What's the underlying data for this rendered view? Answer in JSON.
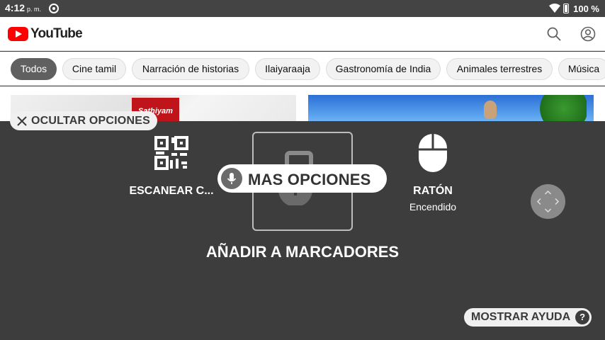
{
  "status_bar": {
    "time": "4:12",
    "ampm": "p. m.",
    "battery": "100 %"
  },
  "header": {
    "logo_text": "YouTube",
    "icons": [
      "search-icon",
      "account-icon"
    ]
  },
  "chips": [
    "Todos",
    "Cine tamil",
    "Narración de historias",
    "Ilaiyaraaja",
    "Gastronomía de India",
    "Animales terrestres",
    "Música"
  ],
  "thumbs": {
    "channel_logo": "Sathiyam"
  },
  "overlay": {
    "hide_label": "OCULTAR OPCIONES",
    "scan_label": "ESCANEAR C...",
    "mouse_label": "RATÓN",
    "mouse_status": "Encendido",
    "bookmark_label": "AÑADIR A MARCADORES",
    "voice_label": "MAS OPCIONES",
    "help_label": "MOSTRAR AYUDA",
    "help_icon": "?"
  },
  "colors": {
    "overlay_bg": "#3d3d3d",
    "yt_red": "#ff0000",
    "chip_selected": "#606060"
  }
}
